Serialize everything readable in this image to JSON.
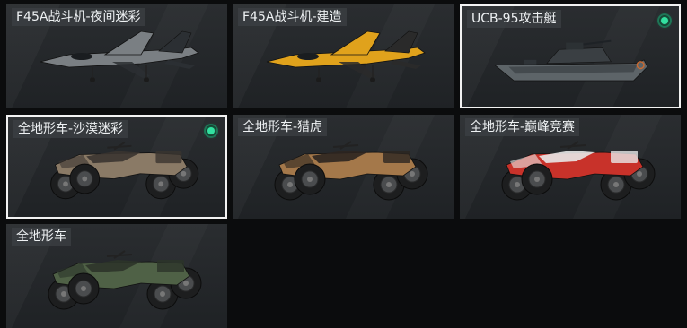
{
  "items": [
    {
      "name": "F45A战斗机-夜间迷彩",
      "type": "jet",
      "skin": "night-camo",
      "equipped": false,
      "selected": false,
      "colors": {
        "body": "#7a7f83",
        "accent": "#2b2f33"
      }
    },
    {
      "name": "F45A战斗机-建造",
      "type": "jet",
      "skin": "construction",
      "equipped": false,
      "selected": false,
      "colors": {
        "body": "#e0a21c",
        "accent": "#2a2a2a"
      }
    },
    {
      "name": "UCB-95攻击艇",
      "type": "boat",
      "skin": "default",
      "equipped": true,
      "selected": true,
      "colors": {
        "body": "#5d6468",
        "accent": "#3a3f43"
      }
    },
    {
      "name": "全地形车-沙漠迷彩",
      "type": "atv",
      "skin": "desert-camo",
      "equipped": true,
      "selected": true,
      "colors": {
        "body": "#8a7a66",
        "accent": "#3a3430"
      }
    },
    {
      "name": "全地形车-猎虎",
      "type": "atv",
      "skin": "tiger",
      "equipped": false,
      "selected": false,
      "colors": {
        "body": "#a4784a",
        "accent": "#2c2520"
      }
    },
    {
      "name": "全地形车-巅峰竞赛",
      "type": "atv",
      "skin": "race",
      "equipped": false,
      "selected": false,
      "colors": {
        "body": "#c8322a",
        "accent": "#e8e8e8"
      }
    },
    {
      "name": "全地形车",
      "type": "atv",
      "skin": "default",
      "equipped": false,
      "selected": false,
      "colors": {
        "body": "#4f6146",
        "accent": "#2c3429"
      }
    }
  ],
  "indicator_color": "#33e0a0"
}
